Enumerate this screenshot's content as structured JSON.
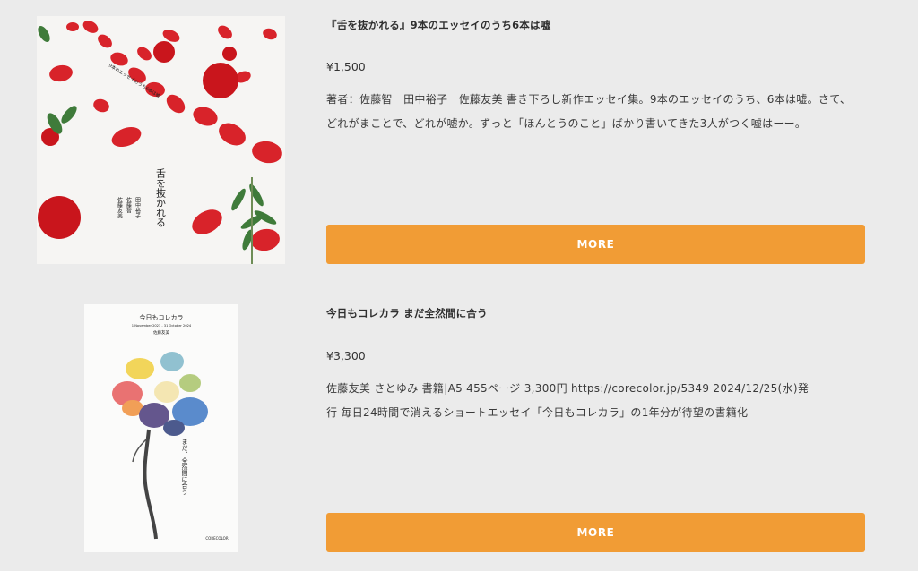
{
  "colors": {
    "page_background": "#ebebeb",
    "button_background": "#f19c35",
    "button_text": "#ffffff"
  },
  "products": [
    {
      "title": "『舌を抜かれる』9本のエッセイのうち6本は嘘",
      "price": "¥1,500",
      "description_lines": [
        "著者：佐藤智　田中裕子　佐藤友美 書き下ろし新作エッセイ集。9本のエッセイのうち、6本は嘘。さて、",
        "どれがまことで、どれが嘘か。ずっと「ほんとうのこと」ばかり書いてきた3人がつく嘘はーー。"
      ],
      "more_label": "MORE",
      "cover": {
        "vertical_title": "舌を抜かれる",
        "authors": [
          "田中裕子",
          "佐藤智",
          "佐藤友美"
        ],
        "diagonal_text": "9本のエッセイのうち6本は嘘"
      }
    },
    {
      "title": "今日もコレカラ まだ全然間に合う",
      "price": "¥3,300",
      "description_lines": [
        "佐藤友美 さとゆみ 書籍|A5 455ページ 3,300円 https://corecolor.jp/5349 2024/12/25(水)発",
        "行 毎日24時間で消えるショートエッセイ「今日もコレカラ」の1年分が待望の書籍化"
      ],
      "more_label": "MORE",
      "cover": {
        "top_title": "今日もコレカラ",
        "top_small": "1 November 2023 - 31 October 2024",
        "author": "佐藤友美",
        "vertical_text": "まだ、全然間に合う",
        "publisher": "CORECOLOR"
      }
    }
  ]
}
